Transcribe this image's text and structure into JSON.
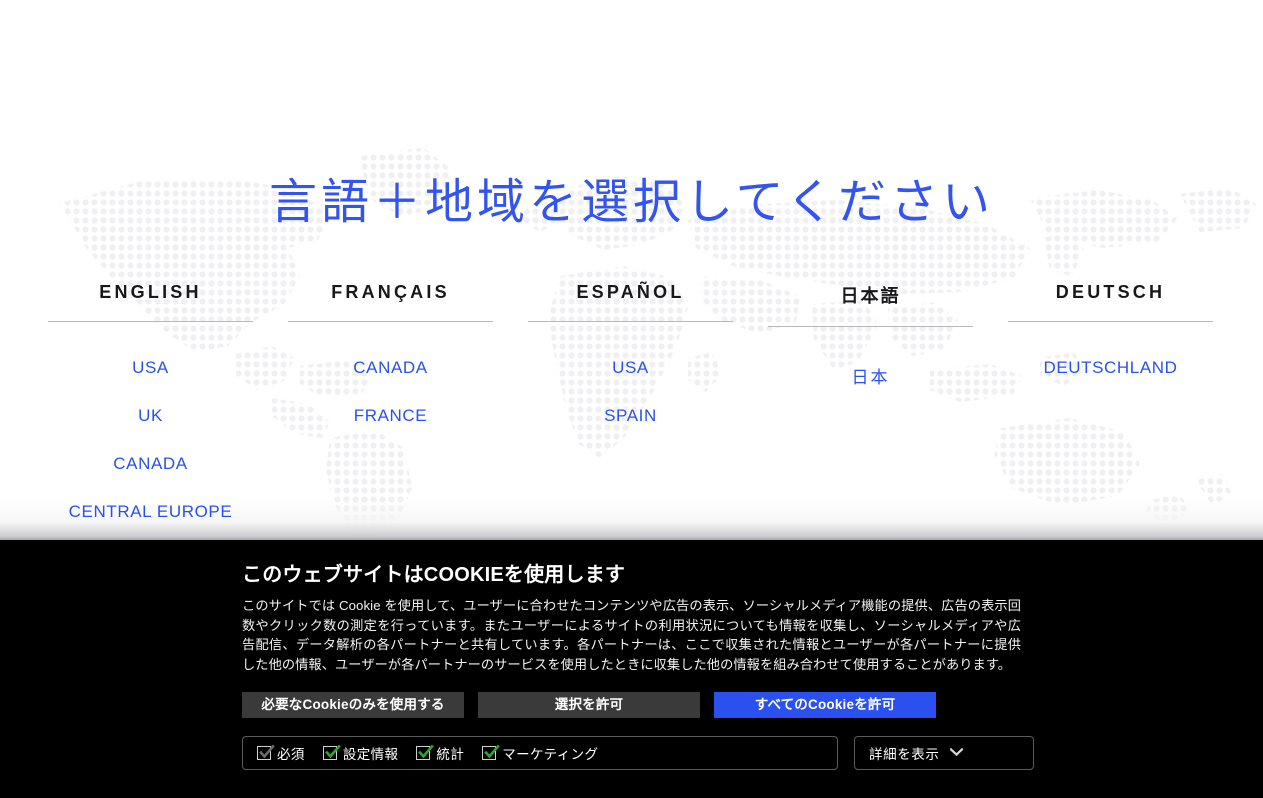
{
  "selector": {
    "title": "言語＋地域を選択してください",
    "columns": [
      {
        "language": "ENGLISH",
        "cjk": false,
        "regions": [
          "USA",
          "UK",
          "CANADA",
          "CENTRAL EUROPE"
        ]
      },
      {
        "language": "FRANÇAIS",
        "cjk": false,
        "regions": [
          "CANADA",
          "FRANCE"
        ]
      },
      {
        "language": "ESPAÑOL",
        "cjk": false,
        "regions": [
          "USA",
          "SPAIN"
        ]
      },
      {
        "language": "日本語",
        "cjk": true,
        "regions": [
          "日本"
        ]
      },
      {
        "language": "DEUTSCH",
        "cjk": false,
        "regions": [
          "DEUTSCHLAND"
        ]
      }
    ]
  },
  "cookie_banner": {
    "title": "このウェブサイトはCOOKIEを使用します",
    "body": "このサイトでは Cookie を使用して、ユーザーに合わせたコンテンツや広告の表示、ソーシャルメディア機能の提供、広告の表示回数やクリック数の測定を行っています。またユーザーによるサイトの利用状況についても情報を収集し、ソーシャルメディアや広告配信、データ解析の各パートナーと共有しています。各パートナーは、ここで収集された情報とユーザーが各パートナーに提供した他の情報、ユーザーが各パートナーのサービスを使用したときに収集した他の情報を組み合わせて使用することがあります。",
    "buttons": {
      "deny": "必要なCookieのみを使用する",
      "selection": "選択を許可",
      "allow_all": "すべてのCookieを許可"
    },
    "consents": [
      {
        "label": "必須",
        "checked": true,
        "disabled": true
      },
      {
        "label": "設定情報",
        "checked": true,
        "disabled": false
      },
      {
        "label": "統計",
        "checked": true,
        "disabled": false
      },
      {
        "label": "マーケティング",
        "checked": true,
        "disabled": false
      }
    ],
    "details_toggle": {
      "label": "詳細を表示",
      "icon": "chevron-down-icon"
    }
  },
  "colors": {
    "link_blue": "#2b50f0",
    "title_blue": "#3355ee",
    "banner_bg": "#000000",
    "button_gray": "#3a3a3a",
    "button_blue": "#2b50f0",
    "check_green": "#2fa52f",
    "check_gray": "#6a6a6a",
    "map_dot": "#f0f0f2"
  }
}
